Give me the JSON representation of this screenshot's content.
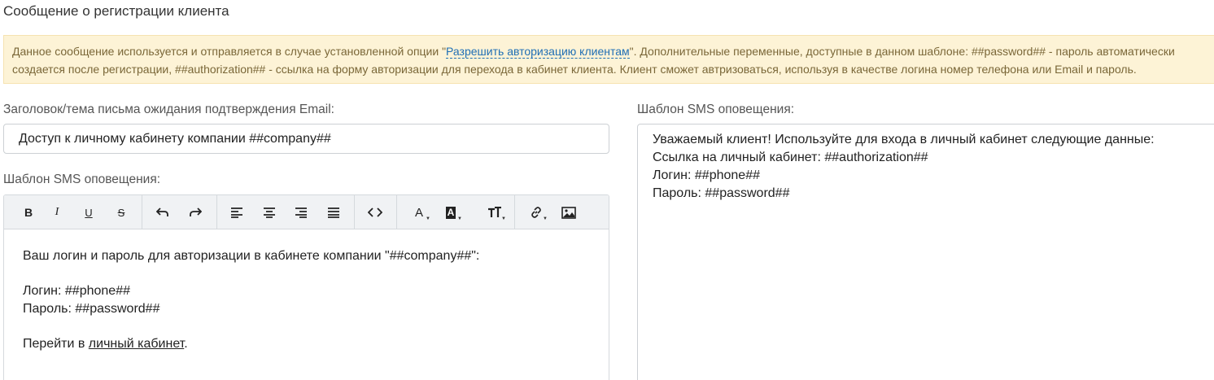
{
  "page": {
    "title": "Сообщение о регистрации клиента"
  },
  "notice": {
    "text_before_link": "Данное сообщение используется и отправляется в случае установленной опции \"",
    "link_text": "Разрешить авторизацию клиентам",
    "text_after_link": "\". Дополнительные переменные, доступные в данном шаблоне: ##password## - пароль автоматически",
    "line2": "создается после регистрации, ##authorization## - ссылка на форму авторизации для перехода в кабинет клиента. Клиент сможет автризоваться, используя в качестве логина номер телефона или Email и пароль."
  },
  "email_subject": {
    "label": "Заголовок/тема письма ожидания подтверждения Email:",
    "value": "Доступ к личному кабинету компании ##company##"
  },
  "email_template": {
    "label": "Шаблон SMS оповещения:",
    "toolbar": {
      "bold": "B",
      "italic": "I",
      "underline": "U",
      "strike": "S",
      "font_color": "A",
      "bg_color": "A"
    },
    "body": {
      "line1": "Ваш логин и пароль для авторизации в кабинете компании \"##company##\":",
      "line2": "Логин: ##phone##",
      "line3": "Пароль: ##password##",
      "line4_prefix": "Перейти в ",
      "line4_link": "личный кабинет",
      "line4_suffix": "."
    }
  },
  "sms_template": {
    "label": "Шаблон SMS оповещения:",
    "line1": "Уважаемый клиент! Используйте для входа в личный кабинет следующие данные:",
    "line2": "Ссылка на личный кабинет: ##authorization##",
    "line3": "Логин: ##phone##",
    "line4": "Пароль: ##password##"
  },
  "colors": {
    "notice_bg": "#fdf3d6",
    "notice_text": "#7a6738",
    "link": "#1f6fb5",
    "toolbar_bg": "#f0f2f4"
  }
}
